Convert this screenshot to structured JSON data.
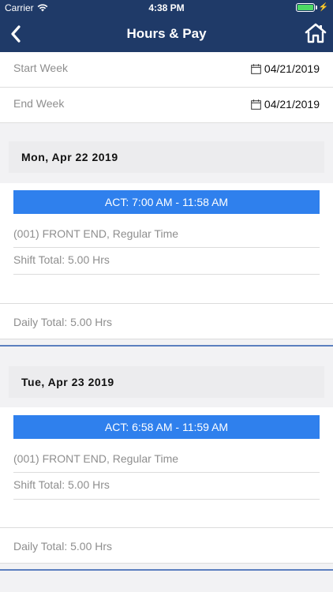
{
  "status_bar": {
    "carrier": "Carrier",
    "time": "4:38 PM"
  },
  "nav": {
    "title": "Hours & Pay",
    "back_icon": "chevron-left-icon",
    "home_icon": "home-icon"
  },
  "filters": {
    "start_label": "Start Week",
    "start_value": "04/21/2019",
    "end_label": "End Week",
    "end_value": "04/21/2019"
  },
  "days": [
    {
      "date": "Mon, Apr 22 2019",
      "act": "ACT: 7:00 AM - 11:58 AM",
      "job": "(001) FRONT END, Regular Time",
      "shift_total": "Shift Total: 5.00 Hrs",
      "daily_total": "Daily Total: 5.00 Hrs"
    },
    {
      "date": "Tue, Apr 23 2019",
      "act": "ACT: 6:58 AM - 11:59 AM",
      "job": "(001) FRONT END, Regular Time",
      "shift_total": "Shift Total: 5.00 Hrs",
      "daily_total": "Daily Total: 5.00 Hrs"
    }
  ],
  "colors": {
    "nav_background": "#1f3a68",
    "act_bar": "#2f80ed",
    "day_divider": "#5b7fbf"
  }
}
